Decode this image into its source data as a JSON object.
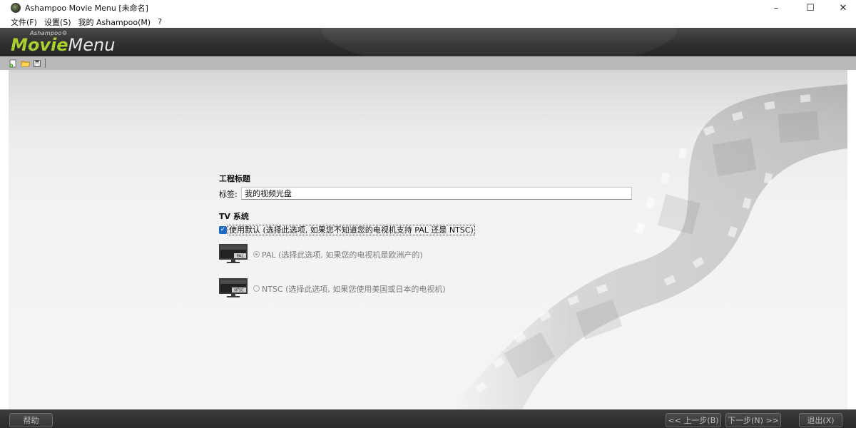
{
  "window": {
    "title": "Ashampoo Movie Menu [未命名]",
    "controls": {
      "minimize": "–",
      "maximize": "☐",
      "close": "✕"
    }
  },
  "menubar": {
    "items": [
      "文件(F)",
      "设置(S)",
      "我的 Ashampoo(M)",
      "?"
    ]
  },
  "brand": {
    "small": "Ashampoo®",
    "movie": "Movie",
    "menu": "Menu",
    "movie_color": "#a8d130"
  },
  "toolbar": {
    "icons": [
      "new-project-icon",
      "open-folder-icon",
      "save-icon"
    ]
  },
  "project": {
    "section_title": "工程标题",
    "label": "标签:",
    "value": "我的视频光盘"
  },
  "tv": {
    "section_title": "TV 系统",
    "use_default_label": "使用默认 (选择此选项, 如果您不知道您的电视机支持 PAL 还是 NTSC)",
    "use_default_checked": true,
    "pal_badge": "PAL",
    "pal_label": "PAL (选择此选项, 如果您的电视机是欧洲产的)",
    "ntsc_badge": "NTSC",
    "ntsc_label": "NTSC (选择此选项, 如果您使用美国或日本的电视机)",
    "selected": "PAL"
  },
  "bottom": {
    "help": "帮助",
    "back": "<< 上一步(B)",
    "next": "下一步(N) >>",
    "exit": "退出(X)"
  },
  "colors": {
    "accent": "#1f67c4",
    "banner": "#2e2e2e",
    "toolbar": "#b9b9b9"
  }
}
